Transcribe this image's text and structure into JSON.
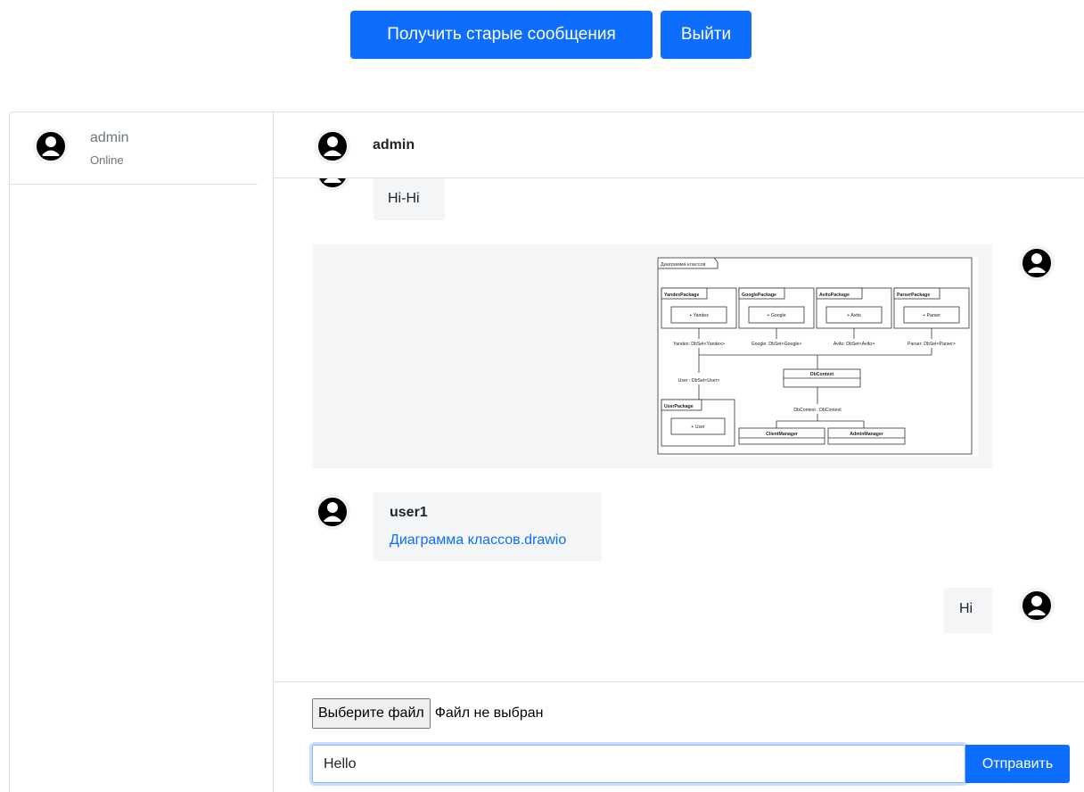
{
  "toolbar": {
    "old_messages_label": "Получить старые сообщения",
    "exit_label": "Выйти",
    "accent_color": "#0d6efd"
  },
  "sidebar": {
    "contacts": [
      {
        "name": "admin",
        "status": "Online",
        "icon": "user-avatar-icon"
      }
    ]
  },
  "chat": {
    "header": {
      "name": "admin",
      "icon": "user-avatar-icon"
    },
    "messages": [
      {
        "text": "Hi-Hi",
        "side": "left"
      },
      {
        "type": "image",
        "side": "right",
        "diagram": {
          "frame_title": "Диаграмма классов",
          "packages": [
            {
              "name": "YandexPackage",
              "item": "+ Yandex",
              "prop": "Yandex: DbSet<Yandex>"
            },
            {
              "name": "GooglePackage",
              "item": "+ Google",
              "prop": "Google: DbSet<Google>"
            },
            {
              "name": "AvitoPackage",
              "item": "+ Avito",
              "prop": "Avito: DbSet<Avito>"
            },
            {
              "name": "ParserPackage",
              "item": "+ Parser",
              "prop": "Parser: DbSet<Parser>"
            }
          ],
          "user_prop": "User : DbSet<User>",
          "user_package": {
            "name": "UserPackage",
            "item": "+ User"
          },
          "dbcontext": "DbContext",
          "dbcontext_prop": "DbContext : DbContext",
          "client_manager": "ClientManager",
          "admin_manager": "AdminManager"
        }
      },
      {
        "sender": "user1",
        "file_name": "Диаграмма классов.drawio",
        "side": "left"
      },
      {
        "text": "Hi",
        "side": "right"
      }
    ]
  },
  "composer": {
    "file_button_label": "Выберите файл",
    "file_status": "Файл не выбран",
    "input_value": "Hello",
    "send_label": "Отправить"
  }
}
